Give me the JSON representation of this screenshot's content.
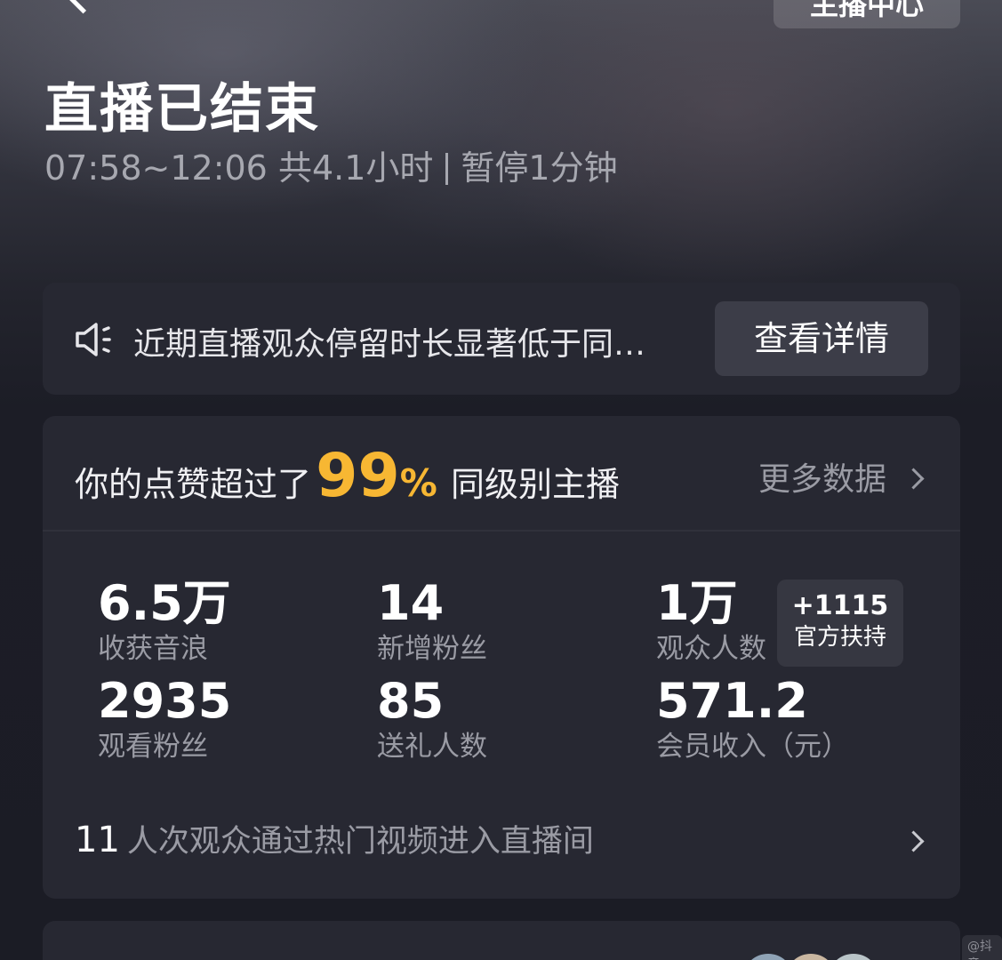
{
  "header": {
    "top_right_button_label": "主播中心",
    "title": "直播已结束",
    "time_range": "07:58~12:06",
    "duration": "共4.1小时",
    "pause": "暂停1分钟"
  },
  "notice": {
    "icon": "speaker-icon",
    "text": "近期直播观众停留时长显著低于同…",
    "button_label": "查看详情"
  },
  "likes": {
    "prefix": "你的点赞超过了",
    "percent_value": "99",
    "percent_sign": "%",
    "suffix": "同级别主播",
    "more_label": "更多数据"
  },
  "stats": [
    {
      "value": "6.5万",
      "label": "收获音浪"
    },
    {
      "value": "14",
      "label": "新增粉丝"
    },
    {
      "value": "1万",
      "label": "观众人数"
    },
    {
      "value": "2935",
      "label": "观看粉丝"
    },
    {
      "value": "85",
      "label": "送礼人数"
    },
    {
      "value": "571.2",
      "label": "会员收入（元）"
    }
  ],
  "support_badge": {
    "value": "+1115",
    "label": "官方扶持"
  },
  "hot_video": {
    "count": "11",
    "text": "人次观众通过热门视频进入直播间"
  },
  "watermark": "@抖音"
}
